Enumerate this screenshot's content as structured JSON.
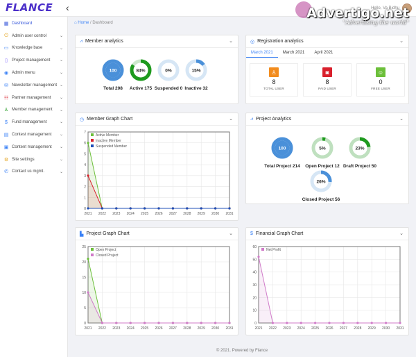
{
  "header": {
    "logo": "FLANCE",
    "user_greeting": "Hello, Va Bidhu",
    "watermark_main": "Advertigo.net",
    "watermark_sub": "\"Advertising the world\""
  },
  "sidebar": {
    "items": [
      {
        "label": "Dashboard",
        "icon": "dashboard-icon",
        "glyph": "▦",
        "active": true,
        "chevron": false
      },
      {
        "label": "Admin user control",
        "icon": "power-icon",
        "glyph": "⏻",
        "active": false,
        "chevron": true
      },
      {
        "label": "Knowledge base",
        "icon": "book-icon",
        "glyph": "▭",
        "active": false,
        "chevron": true
      },
      {
        "label": "Project management",
        "icon": "file-icon",
        "glyph": "▯",
        "active": false,
        "chevron": true
      },
      {
        "label": "Admin menu",
        "icon": "person-icon",
        "glyph": "◉",
        "active": false,
        "chevron": true
      },
      {
        "label": "Newsletter management",
        "icon": "mail-icon",
        "glyph": "✉",
        "active": false,
        "chevron": true
      },
      {
        "label": "Partner management",
        "icon": "group-icon",
        "glyph": "☷",
        "active": false,
        "chevron": true
      },
      {
        "label": "Member management",
        "icon": "user-icon",
        "glyph": "♙",
        "active": false,
        "chevron": true
      },
      {
        "label": "Fund management",
        "icon": "dollar-icon",
        "glyph": "$",
        "active": false,
        "chevron": true
      },
      {
        "label": "Contest management",
        "icon": "contest-icon",
        "glyph": "▤",
        "active": false,
        "chevron": true
      },
      {
        "label": "Content management",
        "icon": "content-icon",
        "glyph": "▣",
        "active": false,
        "chevron": true
      },
      {
        "label": "Site settings",
        "icon": "settings-icon",
        "glyph": "⚙",
        "active": false,
        "chevron": true
      },
      {
        "label": "Contact us mgmt.",
        "icon": "phone-icon",
        "glyph": "✆",
        "active": false,
        "chevron": true
      }
    ]
  },
  "breadcrumb": {
    "home": "Home",
    "separator": "/",
    "current": "Dashboard"
  },
  "member_analytics": {
    "title": "Member analytics",
    "donuts": [
      {
        "value": "100",
        "label": "Total 208",
        "fraction": 1.0,
        "color": "#4a90d9",
        "track": "#cfe0f2"
      },
      {
        "value": "84%",
        "label": "Active 175",
        "fraction": 0.84,
        "color": "#1e9a1e",
        "track": "#cde8cd"
      },
      {
        "value": "0%",
        "label": "Suspended 0",
        "fraction": 0.0,
        "color": "#4a90d9",
        "track": "#d6e6f5"
      },
      {
        "value": "15%",
        "label": "Inactive 32",
        "fraction": 0.15,
        "color": "#4a90d9",
        "track": "#d6e6f5"
      }
    ]
  },
  "registration": {
    "title": "Registration analytics",
    "tabs": [
      "March 2021",
      "March 2021",
      "April 2021"
    ],
    "active_tab": 0,
    "boxes": [
      {
        "value": "8",
        "label": "TOTAL USER",
        "icon": "user-icon",
        "glyph": "♙",
        "color": "#f28c1e"
      },
      {
        "value": "8",
        "label": "PAID USER",
        "icon": "paid-icon",
        "glyph": "◙",
        "color": "#d9202c"
      },
      {
        "value": "0",
        "label": "FREE USER",
        "icon": "smile-icon",
        "glyph": "☺",
        "color": "#6cbf3a"
      }
    ]
  },
  "member_graph": {
    "title": "Member Graph Chart",
    "chart_data": {
      "type": "line",
      "x": [
        "2021",
        "2022",
        "2023",
        "2024",
        "2025",
        "2026",
        "2027",
        "2028",
        "2029",
        "2030",
        "2031"
      ],
      "ylim": [
        0,
        7
      ],
      "yticks": [
        0,
        1,
        2,
        3,
        4,
        5,
        6,
        7
      ],
      "series": [
        {
          "name": "Active Member",
          "color": "#6cbf3a",
          "values": [
            6,
            0,
            0,
            0,
            0,
            0,
            0,
            0,
            0,
            0,
            0
          ]
        },
        {
          "name": "Inactive Member",
          "color": "#d9202c",
          "values": [
            3,
            0,
            0,
            0,
            0,
            0,
            0,
            0,
            0,
            0,
            0
          ]
        },
        {
          "name": "Suspended Member",
          "color": "#1f4fb8",
          "values": [
            0,
            0,
            0,
            0,
            0,
            0,
            0,
            0,
            0,
            0,
            0
          ]
        }
      ],
      "legend": "top-left",
      "grid": true
    }
  },
  "project_analytics": {
    "title": "Project Analytics",
    "donuts": [
      {
        "value": "100",
        "label": "Total Project 214",
        "fraction": 1.0,
        "color": "#4a90d9",
        "track": "#cfe0f2"
      },
      {
        "value": "5%",
        "label": "Open Project 12",
        "fraction": 0.05,
        "color": "#1e9a1e",
        "track": "#bfe0bf"
      },
      {
        "value": "23%",
        "label": "Draft Project 50",
        "fraction": 0.23,
        "color": "#1e9a1e",
        "track": "#bfe0bf"
      },
      {
        "value": "26%",
        "label": "Closed Project 56",
        "fraction": 0.26,
        "color": "#4a90d9",
        "track": "#d6e6f5"
      }
    ]
  },
  "project_graph": {
    "title": "Project Graph Chart",
    "chart_data": {
      "type": "line",
      "x": [
        "2021",
        "2022",
        "2023",
        "2024",
        "2025",
        "2026",
        "2027",
        "2028",
        "2029",
        "2030",
        "2031"
      ],
      "ylim": [
        0,
        25
      ],
      "yticks": [
        0,
        5,
        10,
        15,
        20,
        25
      ],
      "series": [
        {
          "name": "Open Project",
          "color": "#6cbf3a",
          "values": [
            21,
            0,
            0,
            0,
            0,
            0,
            0,
            0,
            0,
            0,
            0
          ]
        },
        {
          "name": "Closed Project",
          "color": "#d07bc9",
          "values": [
            10,
            0,
            0,
            0,
            0,
            0,
            0,
            0,
            0,
            0,
            0
          ]
        }
      ],
      "legend": "top-left",
      "grid": true
    }
  },
  "financial_graph": {
    "title": "Financial Graph Chart",
    "chart_data": {
      "type": "line",
      "x": [
        "2021",
        "2022",
        "2023",
        "2024",
        "2025",
        "2026",
        "2027",
        "2028",
        "2029",
        "2030",
        "2031"
      ],
      "ylim": [
        0,
        60
      ],
      "yticks": [
        0,
        10,
        20,
        30,
        40,
        50,
        60
      ],
      "series": [
        {
          "name": "Net Profit",
          "color": "#d07bc9",
          "values": [
            52,
            0,
            0,
            0,
            0,
            0,
            0,
            0,
            0,
            0,
            0
          ]
        }
      ],
      "legend": "top-left",
      "grid": true
    }
  },
  "footer": {
    "text": "© 2021. Powered by Flance"
  }
}
